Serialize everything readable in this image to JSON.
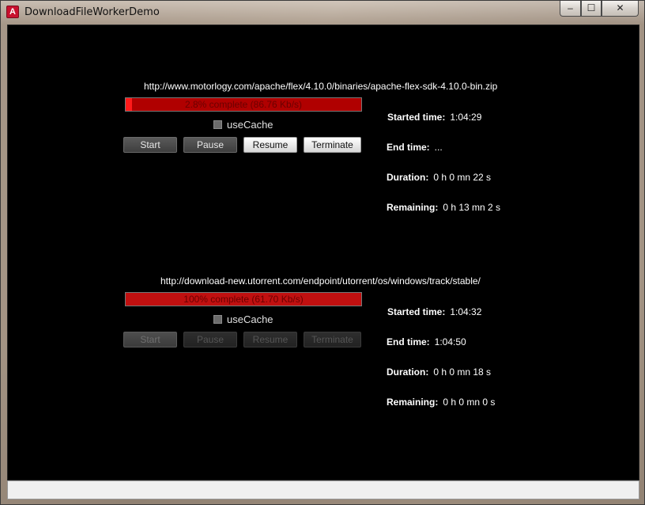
{
  "window": {
    "title": "DownloadFileWorkerDemo",
    "controls": {
      "minimize": "–",
      "maximize": "☐",
      "close": "✕"
    },
    "icon": "adobe-air-icon"
  },
  "downloads": [
    {
      "url": "http://www.motorlogy.com/apache/flex/4.10.0/binaries/apache-flex-sdk-4.10.0-bin.zip",
      "progress_label": "2.8% complete (86.76 Kb/s)",
      "progress_percent": 2.8,
      "use_cache_label": "useCache",
      "use_cache_checked": false,
      "buttons": {
        "start": "Start",
        "pause": "Pause",
        "resume": "Resume",
        "terminate": "Terminate"
      },
      "stats": {
        "started_label": "Started time:",
        "started_value": "1:04:29",
        "end_label": "End time:",
        "end_value": "...",
        "duration_label": "Duration:",
        "duration_value": "0 h 0 mn 22 s",
        "remaining_label": "Remaining:",
        "remaining_value": "0 h 13 mn 2 s"
      }
    },
    {
      "url": "http://download-new.utorrent.com/endpoint/utorrent/os/windows/track/stable/",
      "progress_label": "100% complete (61.70 Kb/s)",
      "progress_percent": 100,
      "use_cache_label": "useCache",
      "use_cache_checked": false,
      "buttons": {
        "start": "Start",
        "pause": "Pause",
        "resume": "Resume",
        "terminate": "Terminate"
      },
      "stats": {
        "started_label": "Started time:",
        "started_value": "1:04:32",
        "end_label": "End time:",
        "end_value": "1:04:50",
        "duration_label": "Duration:",
        "duration_value": "0 h 0 mn 18 s",
        "remaining_label": "Remaining:",
        "remaining_value": "0 h 0 mn 0 s"
      }
    }
  ]
}
